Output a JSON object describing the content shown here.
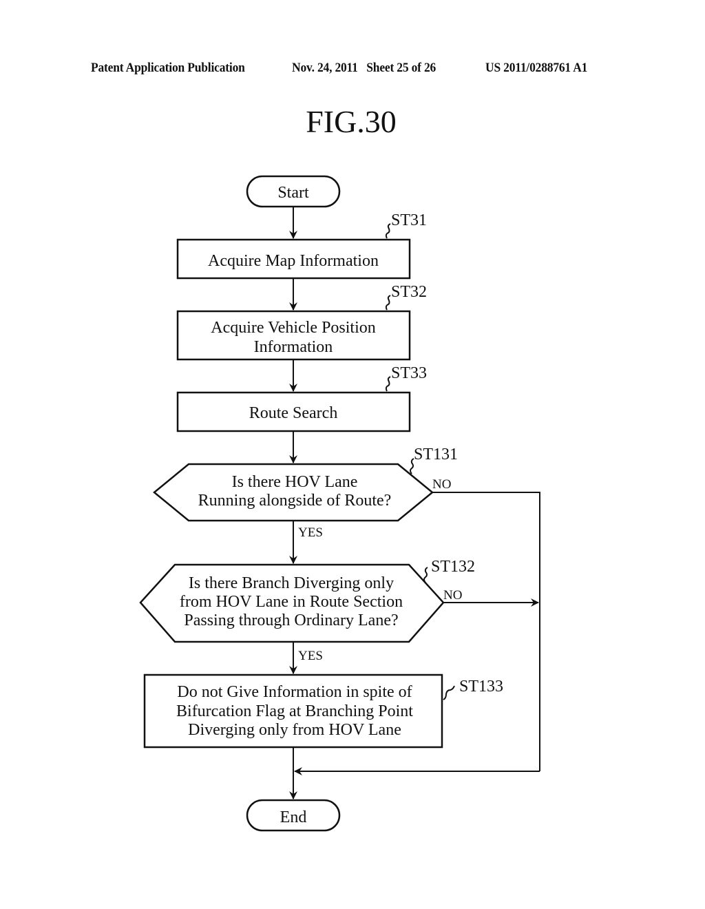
{
  "header": {
    "publication": "Patent Application Publication",
    "date_sheet": "Nov. 24, 2011   Sheet 25 of 26",
    "patent_number": "US 2011/0288761 A1"
  },
  "figure_title": "FIG.30",
  "flowchart": {
    "start": "Start",
    "end": "End",
    "steps": [
      {
        "id": "ST31",
        "type": "process",
        "lines": [
          "Acquire Map Information"
        ]
      },
      {
        "id": "ST32",
        "type": "process",
        "lines": [
          "Acquire Vehicle Position",
          "Information"
        ]
      },
      {
        "id": "ST33",
        "type": "process",
        "lines": [
          "Route Search"
        ]
      },
      {
        "id": "ST131",
        "type": "decision",
        "lines": [
          "Is there HOV Lane",
          "Running alongside of Route?"
        ],
        "yes": "YES",
        "no": "NO"
      },
      {
        "id": "ST132",
        "type": "decision",
        "lines": [
          "Is there Branch Diverging only",
          "from HOV Lane in Route Section",
          "Passing through Ordinary Lane?"
        ],
        "yes": "YES",
        "no": "NO"
      },
      {
        "id": "ST133",
        "type": "process",
        "lines": [
          "Do not Give Information in spite of",
          "Bifurcation Flag at Branching Point",
          "Diverging only from HOV Lane"
        ]
      }
    ]
  }
}
